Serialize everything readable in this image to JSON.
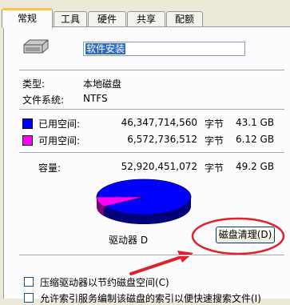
{
  "tabs": [
    {
      "label": "常规",
      "active": true
    },
    {
      "label": "工具",
      "active": false
    },
    {
      "label": "硬件",
      "active": false
    },
    {
      "label": "共享",
      "active": false
    },
    {
      "label": "配额",
      "active": false
    }
  ],
  "drive_name": "软件安装",
  "type": {
    "label": "类型:",
    "value": "本地磁盘"
  },
  "filesystem": {
    "label": "文件系统:",
    "value": "NTFS"
  },
  "used": {
    "label": "已用空间:",
    "bytes": "46,347,714,560",
    "unit": "字节",
    "size": "43.1 GB",
    "color": "#0000ff"
  },
  "free": {
    "label": "可用空间:",
    "bytes": "6,572,736,512",
    "unit": "字节",
    "size": "6.12 GB",
    "color": "#ff00ff"
  },
  "capacity": {
    "label": "容量:",
    "bytes": "52,920,451,072",
    "unit": "字节",
    "size": "49.2 GB"
  },
  "drive_label": "驱动器 D",
  "cleanup_button": "磁盘清理(D)",
  "options": [
    {
      "label": "压缩驱动器以节约磁盘空间(C)",
      "checked": false
    },
    {
      "label": "允许索引服务编制该磁盘的索引以便快速搜索文件(I)",
      "checked": false
    }
  ],
  "annotation_color": "#e0202a"
}
